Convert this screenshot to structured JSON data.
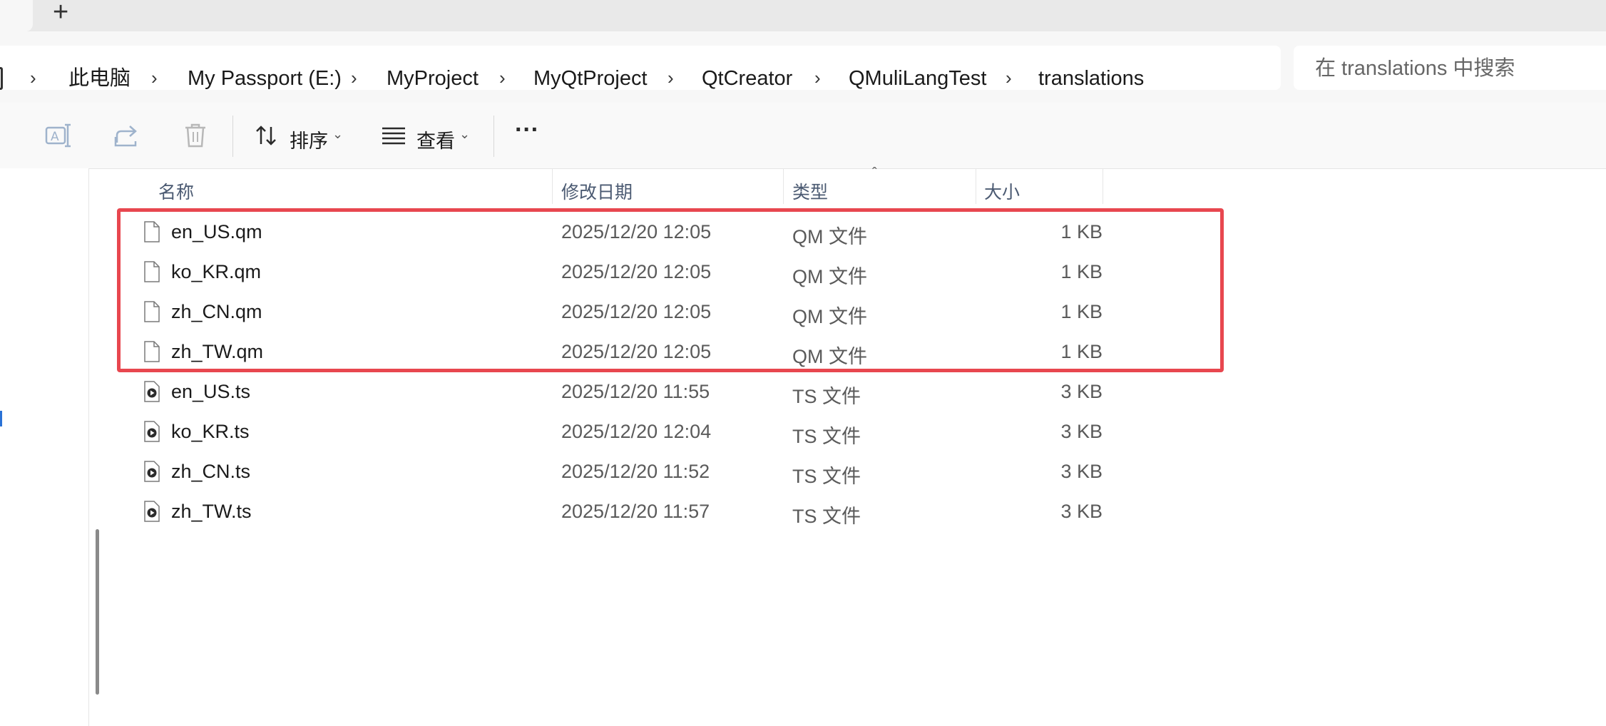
{
  "tabs": {
    "new_tab_symbol": "+",
    "close_symbol": "✕"
  },
  "breadcrumb": [
    "此电脑",
    "My Passport (E:)",
    "MyProject",
    "MyQtProject",
    "QtCreator",
    "QMuliLangTest",
    "translations"
  ],
  "search": {
    "placeholder": "在 translations 中搜索"
  },
  "toolbar": {
    "sort_label": "排序",
    "view_label": "查看",
    "more_label": "···"
  },
  "columns": {
    "name": "名称",
    "date": "修改日期",
    "type": "类型",
    "size": "大小"
  },
  "files": [
    {
      "name": "en_US.qm",
      "date": "2025/12/20 12:05",
      "type": "QM 文件",
      "size": "1 KB",
      "icon": "file-icon"
    },
    {
      "name": "ko_KR.qm",
      "date": "2025/12/20 12:05",
      "type": "QM 文件",
      "size": "1 KB",
      "icon": "file-icon"
    },
    {
      "name": "zh_CN.qm",
      "date": "2025/12/20 12:05",
      "type": "QM 文件",
      "size": "1 KB",
      "icon": "file-icon"
    },
    {
      "name": "zh_TW.qm",
      "date": "2025/12/20 12:05",
      "type": "QM 文件",
      "size": "1 KB",
      "icon": "file-icon"
    },
    {
      "name": "en_US.ts",
      "date": "2025/12/20 11:55",
      "type": "TS 文件",
      "size": "3 KB",
      "icon": "media-file-icon"
    },
    {
      "name": "ko_KR.ts",
      "date": "2025/12/20 12:04",
      "type": "TS 文件",
      "size": "3 KB",
      "icon": "media-file-icon"
    },
    {
      "name": "zh_CN.ts",
      "date": "2025/12/20 11:52",
      "type": "TS 文件",
      "size": "3 KB",
      "icon": "media-file-icon"
    },
    {
      "name": "zh_TW.ts",
      "date": "2025/12/20 11:57",
      "type": "TS 文件",
      "size": "3 KB",
      "icon": "media-file-icon"
    }
  ],
  "colors": {
    "highlight": "#e8474f",
    "accent": "#2a72d6"
  }
}
